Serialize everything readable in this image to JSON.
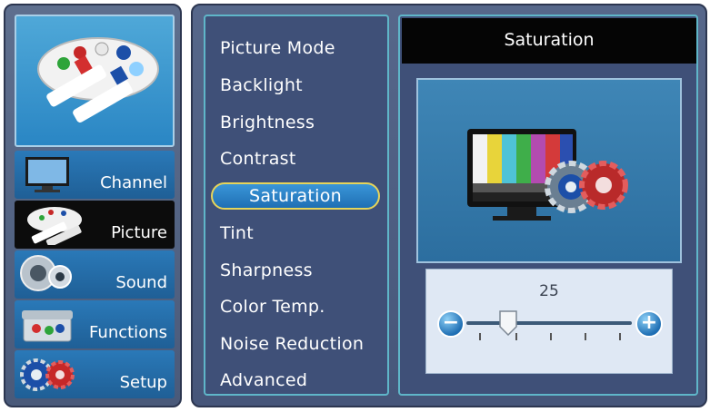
{
  "nav": {
    "items": [
      {
        "label": "Channel",
        "icon": "tv-icon",
        "selected": false
      },
      {
        "label": "Picture",
        "icon": "palette-icon",
        "selected": true
      },
      {
        "label": "Sound",
        "icon": "speaker-icon",
        "selected": false
      },
      {
        "label": "Functions",
        "icon": "toolbox-icon",
        "selected": false
      },
      {
        "label": "Setup",
        "icon": "gears-icon",
        "selected": false
      }
    ],
    "header_icon": "palette-icon"
  },
  "menu": {
    "items": [
      "Picture Mode",
      "Backlight",
      "Brightness",
      "Contrast",
      "Saturation",
      "Tint",
      "Sharpness",
      "Color Temp.",
      "Noise Reduction",
      "Advanced"
    ],
    "selected_label": "Saturation"
  },
  "detail": {
    "title": "Saturation",
    "preview_icon": "color-bars-monitor-gears-icon",
    "slider": {
      "value": "25",
      "min": 0,
      "max": 100,
      "fraction": 0.25
    }
  },
  "colors": {
    "accent": "#1f6fb4",
    "selection_border": "#e6d45a",
    "panel_frame": "#5fb6c9"
  }
}
